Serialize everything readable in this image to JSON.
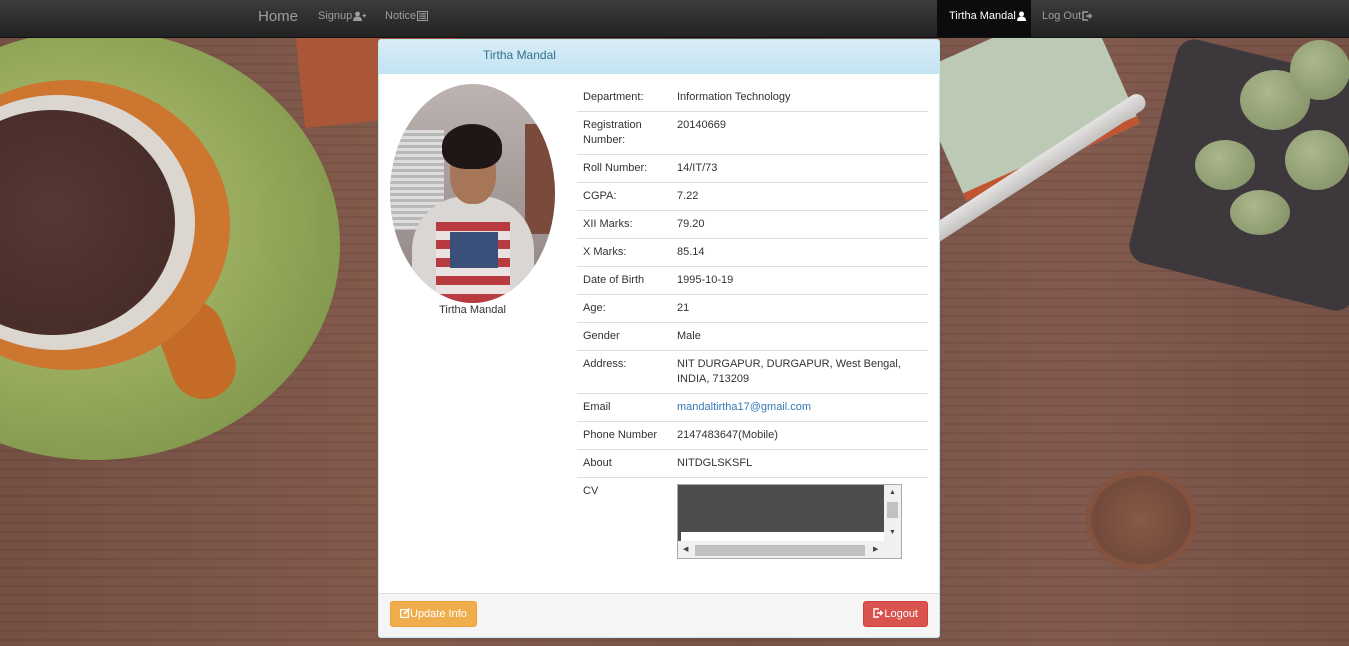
{
  "navbar": {
    "brand": "Home",
    "signup": "Signup",
    "notice": "Notice",
    "user": "Tirtha Mandal",
    "logout": "Log Out",
    "icons": {
      "signup": "add-user-icon",
      "notice": "list-icon",
      "user": "user-icon",
      "logout": "logout-icon"
    }
  },
  "panel": {
    "title": "Tirtha Mandal"
  },
  "profile": {
    "caption": "Tirtha Mandal"
  },
  "details": {
    "department": {
      "label": "Department:",
      "value": "Information Technology"
    },
    "registration": {
      "label": "Registration Number:",
      "value": "20140669"
    },
    "roll": {
      "label": "Roll Number:",
      "value": "14/IT/73"
    },
    "cgpa": {
      "label": "CGPA:",
      "value": "7.22"
    },
    "xii": {
      "label": "XII Marks:",
      "value": "79.20"
    },
    "x": {
      "label": "X Marks:",
      "value": "85.14"
    },
    "dob": {
      "label": "Date of Birth",
      "value": "1995-10-19"
    },
    "age": {
      "label": "Age:",
      "value": "21"
    },
    "gender": {
      "label": "Gender",
      "value": "Male"
    },
    "address": {
      "label": "Address:",
      "value": "NIT DURGAPUR, DURGAPUR, West Bengal, INDIA, 713209"
    },
    "email": {
      "label": "Email",
      "value": "mandaltirtha17@gmail.com"
    },
    "phone": {
      "label": "Phone Number",
      "value": "2147483647(Mobile)"
    },
    "about": {
      "label": "About",
      "value": "NITDGLSKSFL"
    },
    "cv": {
      "label": "CV"
    }
  },
  "footer": {
    "update_label": "Update Info",
    "logout_label": "Logout"
  },
  "colors": {
    "navbar": "#222222",
    "panel_heading": "#d9edf7",
    "heading_text": "#31708f",
    "warning": "#f0ad4e",
    "danger": "#d9534f",
    "link": "#337ab7"
  }
}
